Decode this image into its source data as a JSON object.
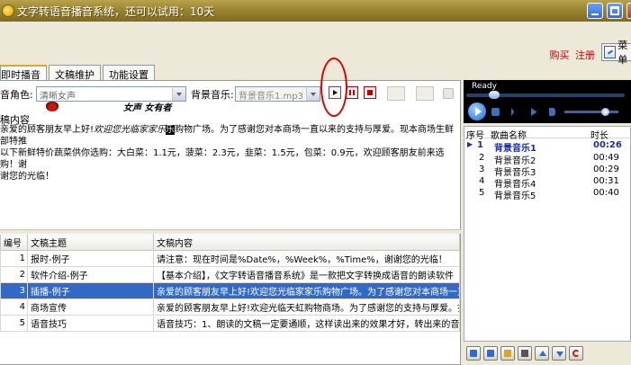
{
  "window": {
    "title": "文字转语音播音系统，还可以试用：10天"
  },
  "top_links": {
    "buy": "购买",
    "register": "注册",
    "menu_label": "菜单"
  },
  "tabs": [
    {
      "label": "即时播音",
      "active": true
    },
    {
      "label": "文稿维护",
      "active": false
    },
    {
      "label": "功能设置",
      "active": false
    }
  ],
  "voice": {
    "label": "音角色:",
    "value": "清晰女声"
  },
  "bgm": {
    "label": "背景音乐:",
    "value": "背景音乐1.mp3"
  },
  "art_text": {
    "left": "欢迎您光临",
    "right": "女声  女有者"
  },
  "content": {
    "label": "稿内容",
    "text_a": "亲爱的顾客朋友早上好!",
    "text_b": "欢迎您光临家家乐",
    "text_hl": "乐",
    "text_c": "购物广场。为了感谢您对本商场一直以来的支持与厚爱。现本商场生鲜部特推",
    "line2": "以下新鲜特价蔬菜供你选购：大白菜：1.1元，菠菜：2.3元，韭菜：1.5元，包菜：0.9元，欢迎顾客朋友前来选购！谢",
    "line3": "谢您的光临！"
  },
  "table": {
    "headers": [
      "编号",
      "文稿主题",
      "文稿内容"
    ],
    "rows": [
      {
        "num": "1",
        "topic": "报时-例子",
        "content": "请注意：现在时间是%Date%，%Week%，%Time%，谢谢您的光临！",
        "selected": false
      },
      {
        "num": "2",
        "topic": "软件介绍-例子",
        "content": "【基本介绍】，《文字转语音播音系统》是一款把文字转换成语音的朗读软件",
        "selected": false
      },
      {
        "num": "3",
        "topic": "插播-例子",
        "content": "亲爱的顾客朋友早上好!欢迎您光临家家乐购物广场。为了感谢您对本商场一直",
        "selected": true
      },
      {
        "num": "4",
        "topic": "商场宣传",
        "content": "亲爱的顾客朋友早上好!欢迎光临天虹购物商场。为了感谢您的支持与厚爱。扑",
        "selected": false
      },
      {
        "num": "5",
        "topic": "语音技巧",
        "content": "语音技巧：1、朗读的文稿一定要通顺，这样读出来的效果才好，转出来的音频",
        "selected": false
      }
    ]
  },
  "player": {
    "status": "Ready",
    "progress_fraction": 0.15,
    "volume_fraction": 0.8
  },
  "playlist": {
    "headers": [
      "序号",
      "歌曲名称",
      "时长"
    ],
    "items": [
      {
        "num": "1",
        "name": "背景音乐1",
        "time": "00:26",
        "current": true
      },
      {
        "num": "2",
        "name": "背景音乐2",
        "time": "00:49",
        "current": false
      },
      {
        "num": "3",
        "name": "背景音乐3",
        "time": "00:29",
        "current": false
      },
      {
        "num": "4",
        "name": "背景音乐4",
        "time": "00:31",
        "current": false
      },
      {
        "num": "5",
        "name": "背景音乐5",
        "time": "00:40",
        "current": false
      }
    ]
  },
  "colors": {
    "selection": "#316ac5",
    "current_song": "#1a2ca8",
    "annotation": "#e10000"
  }
}
